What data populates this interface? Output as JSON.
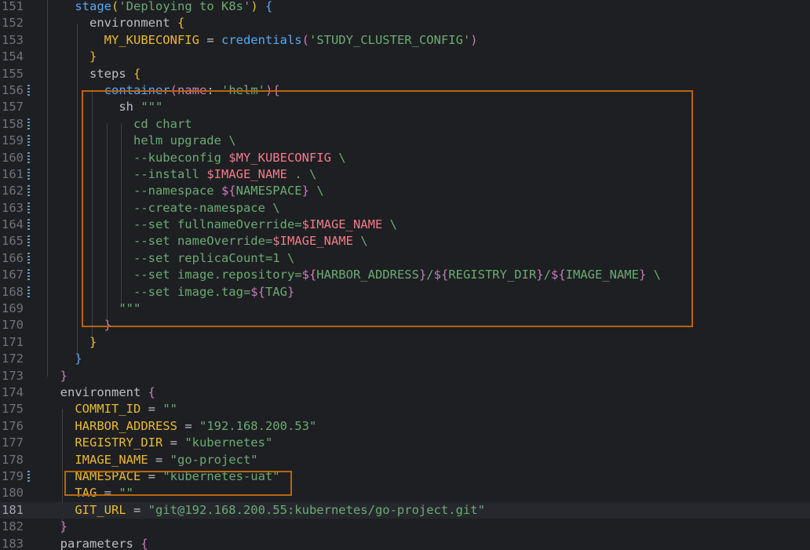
{
  "editor": {
    "current_line": "181",
    "lines": [
      {
        "n": "151",
        "tokens": [
          {
            "t": "    ",
            "c": "t-def"
          },
          {
            "t": "stage",
            "c": "t-fn"
          },
          {
            "t": "(",
            "c": "t-b1"
          },
          {
            "t": "'Deploying to K8s'",
            "c": "t-str"
          },
          {
            "t": ")",
            "c": "t-b1"
          },
          {
            "t": " ",
            "c": "t-def"
          },
          {
            "t": "{",
            "c": "t-b3"
          }
        ]
      },
      {
        "n": "152",
        "tokens": [
          {
            "t": "      environment ",
            "c": "t-def"
          },
          {
            "t": "{",
            "c": "t-b1"
          }
        ]
      },
      {
        "n": "153",
        "tokens": [
          {
            "t": "        ",
            "c": "t-def"
          },
          {
            "t": "MY_KUBECONFIG",
            "c": "t-field"
          },
          {
            "t": " = ",
            "c": "t-def"
          },
          {
            "t": "credentials",
            "c": "t-fn"
          },
          {
            "t": "(",
            "c": "t-b2"
          },
          {
            "t": "'STUDY_CLUSTER_CONFIG'",
            "c": "t-str"
          },
          {
            "t": ")",
            "c": "t-b2"
          }
        ]
      },
      {
        "n": "154",
        "tokens": [
          {
            "t": "      ",
            "c": "t-def"
          },
          {
            "t": "}",
            "c": "t-b1"
          }
        ]
      },
      {
        "n": "155",
        "tokens": [
          {
            "t": "      steps ",
            "c": "t-def"
          },
          {
            "t": "{",
            "c": "t-b1"
          }
        ]
      },
      {
        "n": "156",
        "mark": true,
        "tokens": [
          {
            "t": "        ",
            "c": "t-def"
          },
          {
            "t": "container",
            "c": "t-fn"
          },
          {
            "t": "(",
            "c": "t-b2"
          },
          {
            "t": "name",
            "c": "t-named"
          },
          {
            "t": ": ",
            "c": "t-def"
          },
          {
            "t": "'helm'",
            "c": "t-str"
          },
          {
            "t": ")",
            "c": "t-b2"
          },
          {
            "t": "{",
            "c": "t-b2"
          }
        ]
      },
      {
        "n": "157",
        "tokens": [
          {
            "t": "          sh ",
            "c": "t-def"
          },
          {
            "t": "\"\"\"",
            "c": "t-str"
          }
        ]
      },
      {
        "n": "158",
        "mark": true,
        "tokens": [
          {
            "t": "            cd chart",
            "c": "t-str"
          }
        ]
      },
      {
        "n": "159",
        "mark": true,
        "tokens": [
          {
            "t": "            helm upgrade \\",
            "c": "t-str"
          }
        ]
      },
      {
        "n": "160",
        "mark": true,
        "tokens": [
          {
            "t": "            --kubeconfig ",
            "c": "t-str"
          },
          {
            "t": "$MY_KUBECONFIG",
            "c": "t-shvar"
          },
          {
            "t": " \\",
            "c": "t-str"
          }
        ]
      },
      {
        "n": "161",
        "mark": true,
        "tokens": [
          {
            "t": "            --install ",
            "c": "t-str"
          },
          {
            "t": "$IMAGE_NAME",
            "c": "t-shvar"
          },
          {
            "t": " . \\",
            "c": "t-str"
          }
        ]
      },
      {
        "n": "162",
        "mark": true,
        "tokens": [
          {
            "t": "            --namespace ",
            "c": "t-str"
          },
          {
            "t": "${",
            "c": "t-b2"
          },
          {
            "t": "NAMESPACE",
            "c": "t-interp"
          },
          {
            "t": "}",
            "c": "t-b2"
          },
          {
            "t": " \\",
            "c": "t-str"
          }
        ]
      },
      {
        "n": "163",
        "mark": true,
        "tokens": [
          {
            "t": "            --create-namespace \\",
            "c": "t-str"
          }
        ]
      },
      {
        "n": "164",
        "mark": true,
        "tokens": [
          {
            "t": "            --set fullnameOverride=",
            "c": "t-str"
          },
          {
            "t": "$IMAGE_NAME",
            "c": "t-shvar"
          },
          {
            "t": " \\",
            "c": "t-str"
          }
        ]
      },
      {
        "n": "165",
        "mark": true,
        "tokens": [
          {
            "t": "            --set nameOverride=",
            "c": "t-str"
          },
          {
            "t": "$IMAGE_NAME",
            "c": "t-shvar"
          },
          {
            "t": " \\",
            "c": "t-str"
          }
        ]
      },
      {
        "n": "166",
        "mark": true,
        "tokens": [
          {
            "t": "            --set replicaCount=1 \\",
            "c": "t-str"
          }
        ]
      },
      {
        "n": "167",
        "mark": true,
        "tokens": [
          {
            "t": "            --set image.repository=",
            "c": "t-str"
          },
          {
            "t": "${",
            "c": "t-b2"
          },
          {
            "t": "HARBOR_ADDRESS",
            "c": "t-interp"
          },
          {
            "t": "}",
            "c": "t-b2"
          },
          {
            "t": "/",
            "c": "t-str"
          },
          {
            "t": "${",
            "c": "t-b2"
          },
          {
            "t": "REGISTRY_DIR",
            "c": "t-interp"
          },
          {
            "t": "}",
            "c": "t-b2"
          },
          {
            "t": "/",
            "c": "t-str"
          },
          {
            "t": "${",
            "c": "t-b2"
          },
          {
            "t": "IMAGE_NAME",
            "c": "t-interp"
          },
          {
            "t": "}",
            "c": "t-b2"
          },
          {
            "t": " \\",
            "c": "t-str"
          }
        ]
      },
      {
        "n": "168",
        "mark": true,
        "tokens": [
          {
            "t": "            --set image.tag=",
            "c": "t-str"
          },
          {
            "t": "${",
            "c": "t-b2"
          },
          {
            "t": "TAG",
            "c": "t-interp"
          },
          {
            "t": "}",
            "c": "t-b2"
          }
        ]
      },
      {
        "n": "169",
        "tokens": [
          {
            "t": "          ",
            "c": "t-def"
          },
          {
            "t": "\"\"\"",
            "c": "t-str"
          }
        ]
      },
      {
        "n": "170",
        "tokens": [
          {
            "t": "        ",
            "c": "t-def"
          },
          {
            "t": "}",
            "c": "t-b2"
          }
        ]
      },
      {
        "n": "171",
        "tokens": [
          {
            "t": "      ",
            "c": "t-def"
          },
          {
            "t": "}",
            "c": "t-b1"
          }
        ]
      },
      {
        "n": "172",
        "tokens": [
          {
            "t": "    ",
            "c": "t-def"
          },
          {
            "t": "}",
            "c": "t-b3"
          }
        ]
      },
      {
        "n": "173",
        "tokens": [
          {
            "t": "  ",
            "c": "t-def"
          },
          {
            "t": "}",
            "c": "t-b2"
          }
        ]
      },
      {
        "n": "174",
        "tokens": [
          {
            "t": "  environment ",
            "c": "t-def"
          },
          {
            "t": "{",
            "c": "t-b2"
          }
        ]
      },
      {
        "n": "175",
        "tokens": [
          {
            "t": "    ",
            "c": "t-def"
          },
          {
            "t": "COMMIT_ID",
            "c": "t-field"
          },
          {
            "t": " = ",
            "c": "t-def"
          },
          {
            "t": "\"\"",
            "c": "t-str"
          }
        ]
      },
      {
        "n": "176",
        "tokens": [
          {
            "t": "    ",
            "c": "t-def"
          },
          {
            "t": "HARBOR_ADDRESS",
            "c": "t-field"
          },
          {
            "t": " = ",
            "c": "t-def"
          },
          {
            "t": "\"192.168.200.53\"",
            "c": "t-str"
          }
        ]
      },
      {
        "n": "177",
        "tokens": [
          {
            "t": "    ",
            "c": "t-def"
          },
          {
            "t": "REGISTRY_DIR",
            "c": "t-field"
          },
          {
            "t": " = ",
            "c": "t-def"
          },
          {
            "t": "\"kubernetes\"",
            "c": "t-str"
          }
        ]
      },
      {
        "n": "178",
        "tokens": [
          {
            "t": "    ",
            "c": "t-def"
          },
          {
            "t": "IMAGE_NAME",
            "c": "t-field"
          },
          {
            "t": " = ",
            "c": "t-def"
          },
          {
            "t": "\"go-project\"",
            "c": "t-str"
          }
        ]
      },
      {
        "n": "179",
        "mark": true,
        "tokens": [
          {
            "t": "    ",
            "c": "t-def"
          },
          {
            "t": "NAMESPACE",
            "c": "t-field"
          },
          {
            "t": " = ",
            "c": "t-def"
          },
          {
            "t": "\"kubernetes-uat\"",
            "c": "t-str"
          }
        ]
      },
      {
        "n": "180",
        "tokens": [
          {
            "t": "    ",
            "c": "t-def"
          },
          {
            "t": "TAG",
            "c": "t-field"
          },
          {
            "t": " = ",
            "c": "t-def"
          },
          {
            "t": "\"\"",
            "c": "t-str"
          }
        ]
      },
      {
        "n": "181",
        "tokens": [
          {
            "t": "    ",
            "c": "t-def"
          },
          {
            "t": "GIT_URL",
            "c": "t-field"
          },
          {
            "t": " = ",
            "c": "t-def"
          },
          {
            "t": "\"git@192.168.200.55:kubernetes/go-project.git\"",
            "c": "t-str"
          }
        ]
      },
      {
        "n": "182",
        "tokens": [
          {
            "t": "  ",
            "c": "t-def"
          },
          {
            "t": "}",
            "c": "t-b2"
          }
        ]
      },
      {
        "n": "183",
        "tokens": [
          {
            "t": "  parameters ",
            "c": "t-def"
          },
          {
            "t": "{",
            "c": "t-b2"
          }
        ]
      }
    ]
  }
}
